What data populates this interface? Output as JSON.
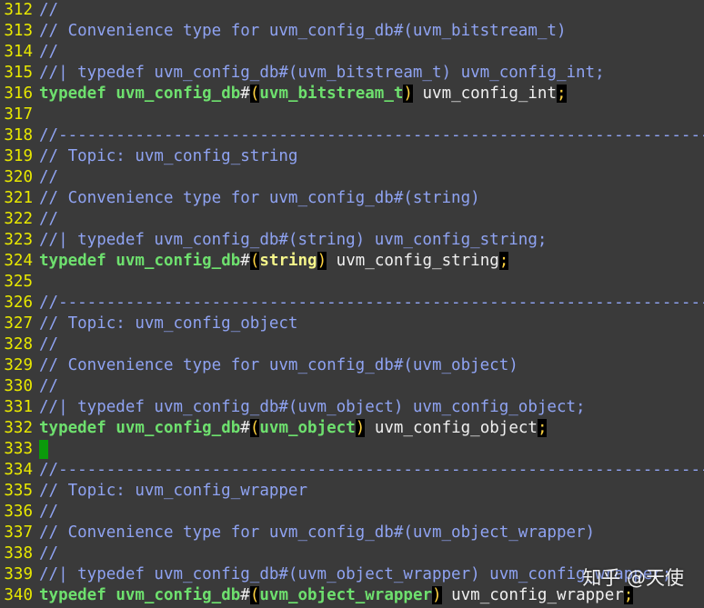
{
  "colors": {
    "background": "#3a3a3a",
    "line_number": "#e8e800",
    "comment": "#8fa3f2",
    "keyword": "#6ee06e",
    "bracket": "#ffd23f",
    "cursor": "#0b9a0b"
  },
  "editor": {
    "lines": [
      {
        "num": "312",
        "segments": [
          {
            "t": "//",
            "c": "comment"
          }
        ]
      },
      {
        "num": "313",
        "segments": [
          {
            "t": "// Convenience type for uvm_config_db#(uvm_bitstream_t)",
            "c": "comment"
          }
        ]
      },
      {
        "num": "314",
        "segments": [
          {
            "t": "//",
            "c": "comment"
          }
        ]
      },
      {
        "num": "315",
        "segments": [
          {
            "t": "//| typedef uvm_config_db#(uvm_bitstream_t) uvm_config_int;",
            "c": "comment"
          }
        ]
      },
      {
        "num": "316",
        "segments": [
          {
            "t": "typedef",
            "c": "keyword"
          },
          {
            "t": " ",
            "c": "ident"
          },
          {
            "t": "uvm_config_db",
            "c": "type-name"
          },
          {
            "t": "#",
            "c": "hash"
          },
          {
            "t": "(",
            "c": "paren"
          },
          {
            "t": "uvm_bitstream_t",
            "c": "type-name"
          },
          {
            "t": ")",
            "c": "paren"
          },
          {
            "t": " uvm_config_int",
            "c": "ident"
          },
          {
            "t": ";",
            "c": "semi"
          }
        ]
      },
      {
        "num": "317",
        "segments": []
      },
      {
        "num": "318",
        "segments": [
          {
            "t": "//----------------------------------------------------------------------",
            "c": "comment"
          }
        ]
      },
      {
        "num": "319",
        "segments": [
          {
            "t": "// Topic: uvm_config_string",
            "c": "comment"
          }
        ]
      },
      {
        "num": "320",
        "segments": [
          {
            "t": "//",
            "c": "comment"
          }
        ]
      },
      {
        "num": "321",
        "segments": [
          {
            "t": "// Convenience type for uvm_config_db#(string)",
            "c": "comment"
          }
        ]
      },
      {
        "num": "322",
        "segments": [
          {
            "t": "//",
            "c": "comment"
          }
        ]
      },
      {
        "num": "323",
        "segments": [
          {
            "t": "//| typedef uvm_config_db#(string) uvm_config_string;",
            "c": "comment"
          }
        ]
      },
      {
        "num": "324",
        "segments": [
          {
            "t": "typedef",
            "c": "keyword"
          },
          {
            "t": " ",
            "c": "ident"
          },
          {
            "t": "uvm_config_db",
            "c": "type-name"
          },
          {
            "t": "#",
            "c": "hash"
          },
          {
            "t": "(",
            "c": "paren"
          },
          {
            "t": "string",
            "c": "string-type"
          },
          {
            "t": ")",
            "c": "paren"
          },
          {
            "t": " uvm_config_string",
            "c": "ident"
          },
          {
            "t": ";",
            "c": "semi"
          }
        ]
      },
      {
        "num": "325",
        "segments": []
      },
      {
        "num": "326",
        "segments": [
          {
            "t": "//----------------------------------------------------------------------",
            "c": "comment"
          }
        ]
      },
      {
        "num": "327",
        "segments": [
          {
            "t": "// Topic: uvm_config_object",
            "c": "comment"
          }
        ]
      },
      {
        "num": "328",
        "segments": [
          {
            "t": "//",
            "c": "comment"
          }
        ]
      },
      {
        "num": "329",
        "segments": [
          {
            "t": "// Convenience type for uvm_config_db#(uvm_object)",
            "c": "comment"
          }
        ]
      },
      {
        "num": "330",
        "segments": [
          {
            "t": "//",
            "c": "comment"
          }
        ]
      },
      {
        "num": "331",
        "segments": [
          {
            "t": "//| typedef uvm_config_db#(uvm_object) uvm_config_object;",
            "c": "comment"
          }
        ]
      },
      {
        "num": "332",
        "segments": [
          {
            "t": "typedef",
            "c": "keyword"
          },
          {
            "t": " ",
            "c": "ident"
          },
          {
            "t": "uvm_config_db",
            "c": "type-name"
          },
          {
            "t": "#",
            "c": "hash"
          },
          {
            "t": "(",
            "c": "paren"
          },
          {
            "t": "uvm_object",
            "c": "type-name"
          },
          {
            "t": ")",
            "c": "paren"
          },
          {
            "t": " uvm_config_object",
            "c": "ident"
          },
          {
            "t": ";",
            "c": "semi"
          }
        ]
      },
      {
        "num": "333",
        "segments": [],
        "cursor": true
      },
      {
        "num": "334",
        "segments": [
          {
            "t": "//----------------------------------------------------------------------",
            "c": "comment"
          }
        ]
      },
      {
        "num": "335",
        "segments": [
          {
            "t": "// Topic: uvm_config_wrapper",
            "c": "comment"
          }
        ]
      },
      {
        "num": "336",
        "segments": [
          {
            "t": "//",
            "c": "comment"
          }
        ]
      },
      {
        "num": "337",
        "segments": [
          {
            "t": "// Convenience type for uvm_config_db#(uvm_object_wrapper)",
            "c": "comment"
          }
        ]
      },
      {
        "num": "338",
        "segments": [
          {
            "t": "//",
            "c": "comment"
          }
        ]
      },
      {
        "num": "339",
        "segments": [
          {
            "t": "//| typedef uvm_config_db#(uvm_object_wrapper) uvm_config_wrapper;",
            "c": "comment"
          }
        ]
      },
      {
        "num": "340",
        "segments": [
          {
            "t": "typedef",
            "c": "keyword"
          },
          {
            "t": " ",
            "c": "ident"
          },
          {
            "t": "uvm_config_db",
            "c": "type-name"
          },
          {
            "t": "#",
            "c": "hash"
          },
          {
            "t": "(",
            "c": "paren"
          },
          {
            "t": "uvm_object_wrapper",
            "c": "type-name"
          },
          {
            "t": ")",
            "c": "paren"
          },
          {
            "t": " uvm_config_wrapper",
            "c": "ident"
          },
          {
            "t": ";",
            "c": "semi"
          }
        ]
      }
    ]
  },
  "watermark": "知乎 @天使"
}
